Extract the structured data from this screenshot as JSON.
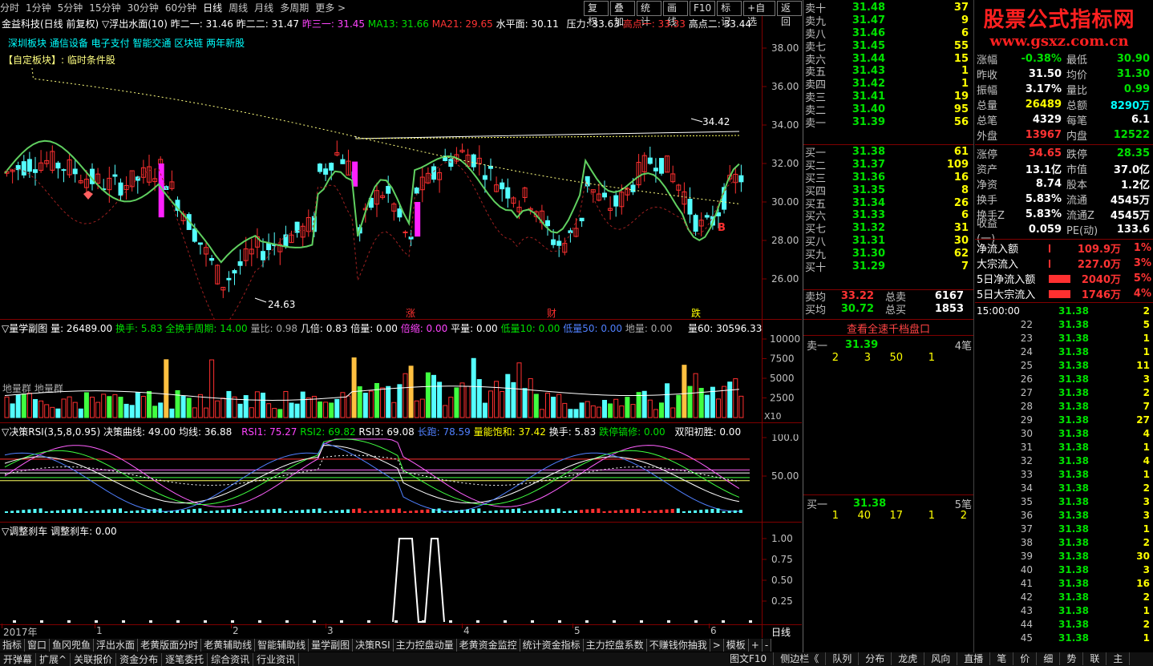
{
  "toolbar": {
    "periods": [
      "分时",
      "1分钟",
      "5分钟",
      "15分钟",
      "30分钟",
      "60分钟",
      "日线",
      "周线",
      "月线",
      "多周期",
      "更多 >"
    ],
    "selected": "日线",
    "right_buttons": [
      "复权",
      "叠加",
      "统计",
      "画线",
      "F10",
      "标记",
      "+自选",
      "返回"
    ]
  },
  "header": {
    "stock": "金益科技(日线 前复权)",
    "indicator": "▽浮出水面(10)",
    "zuo_er_yi": "昨二一: 31.46",
    "zuo_er_er": "昨二二: 31.47",
    "zuo_san_yi": "昨三一: 31.45",
    "ma13": "MA13: 31.66",
    "ma21": "MA21: 29.65",
    "shui_ping_mian": "水平面: 30.11",
    "ya_li": "压力: 33.63",
    "gao_dian_yi": "高点一: 33.33",
    "gao_dian_er": "高点二: 33.44",
    "blocks": "深圳板块  通信设备  电子支付  智能交通  区块链  两年新股",
    "custom_block": "【自定板块】: 临时条件股"
  },
  "main_chart": {
    "y_ticks": [
      "38.00",
      "36.00",
      "34.00",
      "32.00",
      "30.00",
      "28.00",
      "26.00"
    ],
    "annot_high": "34.42",
    "annot_low": "24.63",
    "markers": [
      "涨",
      "财",
      "跌"
    ],
    "b_marker": "B"
  },
  "vol_panel": {
    "title": "▽量学副图",
    "liang": "量: 26489.00",
    "huanshou": "换手: 5.83",
    "quanhuan": "全换手周期: 14.00",
    "liangbi": "量比: 0.98",
    "jibei": "几倍: 0.83",
    "beiliang": "倍量: 0.00",
    "beisuo": "倍缩: 0.00",
    "pingliang": "平量: 0.00",
    "diliang10": "低量10: 0.00",
    "diliang50": "低量50: 0.00",
    "diliang": "地量: 0.00",
    "liang60": "量60: 30596.33",
    "y_ticks": [
      "10000",
      "7500",
      "5000",
      "2500"
    ],
    "unit": "X10",
    "note": "地量群  地量群"
  },
  "rsi_panel": {
    "title": "▽决策RSI(3,5,8,0.95)",
    "quxian": "决策曲线: 49.00",
    "junxian": "均线: 36.88",
    "rsi1": "RSI1: 75.27",
    "rsi2": "RSI2: 69.82",
    "rsi3": "RSI3: 69.08",
    "changpao": "长跑: 78.59",
    "liangneng": "量能饱和: 37.42",
    "huanshou": "换手: 5.83",
    "dietingqiang": "跌停镐修: 0.00",
    "shuangyang": "双阳初胜: 0.00",
    "y_ticks": [
      "100.0",
      "50.00"
    ]
  },
  "adj_panel": {
    "title": "▽调整刹车",
    "value": "调整刹车: 0.00",
    "y_ticks": [
      "1.00",
      "0.75",
      "0.50",
      "0.25"
    ]
  },
  "date_axis": {
    "labels": [
      "2017年",
      "1",
      "2",
      "3",
      "4",
      "5",
      "6"
    ],
    "period": "日线"
  },
  "bottom_tabs": [
    "指标",
    "窗口",
    "鱼冈兜鱼",
    "浮出水面",
    "老黄版面分时",
    "老黄辅助线",
    "智能辅助线",
    "量学副图",
    "决策RSI",
    "主力控盘动量",
    "老黄资金监控",
    "统计资金指标",
    "主力控盘系数",
    "不赚钱你抽我",
    ">",
    "模板",
    "+",
    "-"
  ],
  "status_tabs": [
    "开弹幕",
    "扩展^",
    "关联报价",
    "资金分布",
    "逐笔委托",
    "综合资讯",
    "行业资讯"
  ],
  "status_right": [
    "图文F10",
    "侧边栏《",
    "队列",
    "分布",
    "龙虎",
    "风向",
    "直播",
    "笔",
    "价",
    "细",
    "势",
    "联",
    "主"
  ],
  "orderbook": {
    "asks": [
      {
        "label": "卖十",
        "price": "31.48",
        "vol": "37"
      },
      {
        "label": "卖九",
        "price": "31.47",
        "vol": "9"
      },
      {
        "label": "卖八",
        "price": "31.46",
        "vol": "6"
      },
      {
        "label": "卖七",
        "price": "31.45",
        "vol": "55"
      },
      {
        "label": "卖六",
        "price": "31.44",
        "vol": "15"
      },
      {
        "label": "卖五",
        "price": "31.43",
        "vol": "1"
      },
      {
        "label": "卖四",
        "price": "31.42",
        "vol": "1"
      },
      {
        "label": "卖三",
        "price": "31.41",
        "vol": "19"
      },
      {
        "label": "卖二",
        "price": "31.40",
        "vol": "95"
      },
      {
        "label": "卖一",
        "price": "31.39",
        "vol": "56"
      }
    ],
    "bids": [
      {
        "label": "买一",
        "price": "31.38",
        "vol": "61"
      },
      {
        "label": "买二",
        "price": "31.37",
        "vol": "109"
      },
      {
        "label": "买三",
        "price": "31.36",
        "vol": "16"
      },
      {
        "label": "买四",
        "price": "31.35",
        "vol": "8"
      },
      {
        "label": "买五",
        "price": "31.34",
        "vol": "26"
      },
      {
        "label": "买六",
        "price": "31.33",
        "vol": "6"
      },
      {
        "label": "买七",
        "price": "31.32",
        "vol": "31"
      },
      {
        "label": "买八",
        "price": "31.31",
        "vol": "30"
      },
      {
        "label": "买九",
        "price": "31.30",
        "vol": "62"
      },
      {
        "label": "买十",
        "price": "31.29",
        "vol": "7"
      }
    ],
    "avg_sell_label": "卖均",
    "avg_sell": "33.22",
    "total_sell_label": "总卖",
    "total_sell": "6167",
    "avg_buy_label": "买均",
    "avg_buy": "30.72",
    "total_buy_label": "总买",
    "total_buy": "1853",
    "thousand_title": "查看全速千档盘口",
    "sell1_label": "卖一",
    "sell1_price": "31.39",
    "sell1_count": "4笔",
    "sell1_orders": [
      "2",
      "3",
      "50",
      "1"
    ],
    "buy1_label": "买一",
    "buy1_price": "31.38",
    "buy1_count": "5笔",
    "buy1_orders": [
      "1",
      "40",
      "17",
      "1",
      "2"
    ]
  },
  "quote": {
    "logo_cn": "股票公式指标网",
    "logo_url": "www.gsxz.com.cn",
    "rows": [
      {
        "k1": "涨幅",
        "v1": "-0.38%",
        "c1": "#00e000",
        "k2": "最低",
        "v2": "30.90",
        "c2": "#00e000"
      },
      {
        "k1": "昨收",
        "v1": "31.50",
        "c1": "#ffffff",
        "k2": "均价",
        "v2": "31.30",
        "c2": "#00e000"
      },
      {
        "k1": "振幅",
        "v1": "3.17%",
        "c1": "#ffffff",
        "k2": "量比",
        "v2": "0.99",
        "c2": "#00e000"
      },
      {
        "k1": "总量",
        "v1": "26489",
        "c1": "#ffff00",
        "k2": "总额",
        "v2": "8290万",
        "c2": "#00ffff"
      },
      {
        "k1": "总笔",
        "v1": "4329",
        "c1": "#ffffff",
        "k2": "每笔",
        "v2": "6.1",
        "c2": "#ffffff"
      },
      {
        "k1": "外盘",
        "v1": "13967",
        "c1": "#ff3333",
        "k2": "内盘",
        "v2": "12522",
        "c2": "#00e000"
      }
    ],
    "rows2": [
      {
        "k1": "涨停",
        "v1": "34.65",
        "c1": "#ff3333",
        "k2": "跌停",
        "v2": "28.35",
        "c2": "#00e000"
      },
      {
        "k1": "资产",
        "v1": "13.1亿",
        "c1": "#ffffff",
        "k2": "市值",
        "v2": "37.0亿",
        "c2": "#ffffff"
      },
      {
        "k1": "净资",
        "v1": "8.74",
        "c1": "#ffffff",
        "k2": "股本",
        "v2": "1.2亿",
        "c2": "#ffffff"
      },
      {
        "k1": "换手",
        "v1": "5.83%",
        "c1": "#ffffff",
        "k2": "流通",
        "v2": "4545万",
        "c2": "#ffffff"
      },
      {
        "k1": "换手Z",
        "v1": "5.83%",
        "c1": "#ffffff",
        "k2": "流通Z",
        "v2": "4545万",
        "c2": "#ffffff"
      },
      {
        "k1": "收益(一)",
        "v1": "0.059",
        "c1": "#ffffff",
        "k2": "PE(动)",
        "v2": "133.6",
        "c2": "#ffffff"
      }
    ],
    "flows": [
      {
        "k": "净流入额",
        "v": "109.9万",
        "p": "1%",
        "bar": 0.05
      },
      {
        "k": "大宗流入",
        "v": "227.0万",
        "p": "3%",
        "bar": 0.05
      },
      {
        "k": "5日净流入额",
        "v": "2040万",
        "p": "5%",
        "bar": 0.9
      },
      {
        "k": "5日大宗流入",
        "v": "1746万",
        "p": "4%",
        "bar": 0.9
      }
    ]
  },
  "ticks": {
    "header_time": "15:00:00",
    "header_price": "31.38",
    "header_vol": "2",
    "rows": [
      {
        "t": "22",
        "p": "31.38",
        "v": "5"
      },
      {
        "t": "23",
        "p": "31.38",
        "v": "1"
      },
      {
        "t": "24",
        "p": "31.38",
        "v": "1"
      },
      {
        "t": "25",
        "p": "31.38",
        "v": "11"
      },
      {
        "t": "26",
        "p": "31.38",
        "v": "3"
      },
      {
        "t": "27",
        "p": "31.38",
        "v": "2"
      },
      {
        "t": "28",
        "p": "31.38",
        "v": "7"
      },
      {
        "t": "29",
        "p": "31.38",
        "v": "27"
      },
      {
        "t": "30",
        "p": "31.38",
        "v": "4"
      },
      {
        "t": "31",
        "p": "31.38",
        "v": "1"
      },
      {
        "t": "32",
        "p": "31.38",
        "v": "4"
      },
      {
        "t": "33",
        "p": "31.38",
        "v": "1"
      },
      {
        "t": "34",
        "p": "31.38",
        "v": "2"
      },
      {
        "t": "35",
        "p": "31.38",
        "v": "3"
      },
      {
        "t": "36",
        "p": "31.38",
        "v": "3"
      },
      {
        "t": "37",
        "p": "31.38",
        "v": "1"
      },
      {
        "t": "38",
        "p": "31.38",
        "v": "2"
      },
      {
        "t": "39",
        "p": "31.38",
        "v": "30"
      },
      {
        "t": "40",
        "p": "31.38",
        "v": "3"
      },
      {
        "t": "41",
        "p": "31.38",
        "v": "16"
      },
      {
        "t": "42",
        "p": "31.38",
        "v": "2"
      },
      {
        "t": "43",
        "p": "31.38",
        "v": "1"
      },
      {
        "t": "44",
        "p": "31.38",
        "v": "2"
      },
      {
        "t": "45",
        "p": "31.38",
        "v": "1"
      }
    ]
  }
}
